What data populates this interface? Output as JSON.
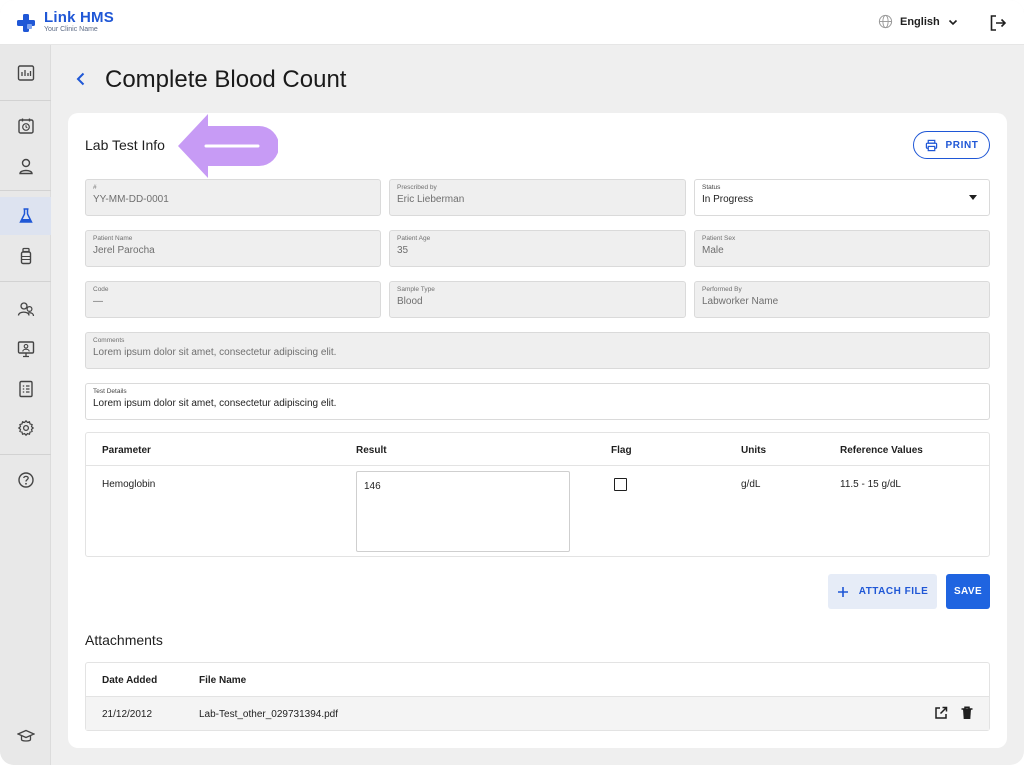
{
  "app": {
    "brand": "Link HMS",
    "subtitle": "Your Clinic Name",
    "language": "English"
  },
  "sidebar": {
    "icons": [
      "dashboard-icon",
      "appointments-icon",
      "patient-icon",
      "lab-flask-icon",
      "pharmacy-bottle-icon",
      "staff-icon",
      "monitor-user-icon",
      "reports-icon",
      "settings-gear-icon",
      "help-icon",
      "academy-cap-icon"
    ],
    "active": "lab-flask-icon"
  },
  "page": {
    "title": "Complete Blood Count"
  },
  "lab_info": {
    "section_title": "Lab Test Info",
    "print_label": "PRINT",
    "fields": {
      "number": {
        "label": "#",
        "value": "YY-MM-DD-0001"
      },
      "prescribed_by": {
        "label": "Prescribed by",
        "value": "Eric Lieberman"
      },
      "status": {
        "label": "Status",
        "value": "In Progress"
      },
      "patient_name": {
        "label": "Patient Name",
        "value": "Jerel Parocha"
      },
      "patient_age": {
        "label": "Patient Age",
        "value": "35"
      },
      "patient_sex": {
        "label": "Patient Sex",
        "value": "Male"
      },
      "code": {
        "label": "Code",
        "value": "—"
      },
      "sample_type": {
        "label": "Sample Type",
        "value": "Blood"
      },
      "performed_by": {
        "label": "Performed By",
        "value": "Labworker Name"
      },
      "comments": {
        "label": "Comments",
        "value": "Lorem ipsum dolor sit amet, consectetur adipiscing elit."
      },
      "test_details": {
        "label": "Test Details",
        "value": "Lorem ipsum dolor sit amet, consectetur adipiscing elit."
      }
    }
  },
  "results": {
    "headers": [
      "Parameter",
      "Result",
      "Flag",
      "Units",
      "Reference Values"
    ],
    "rows": [
      {
        "parameter": "Hemoglobin",
        "result": "146",
        "flag": false,
        "units": "g/dL",
        "reference": "11.5 - 15 g/dL"
      }
    ]
  },
  "actions": {
    "attach_label": "ATTACH FILE",
    "save_label": "SAVE"
  },
  "attachments": {
    "title": "Attachments",
    "headers": [
      "Date Added",
      "File Name"
    ],
    "rows": [
      {
        "date": "21/12/2012",
        "file": "Lab-Test_other_029731394.pdf"
      }
    ]
  },
  "colors": {
    "accent": "#1f57d6",
    "callout": "#c79bf5"
  }
}
